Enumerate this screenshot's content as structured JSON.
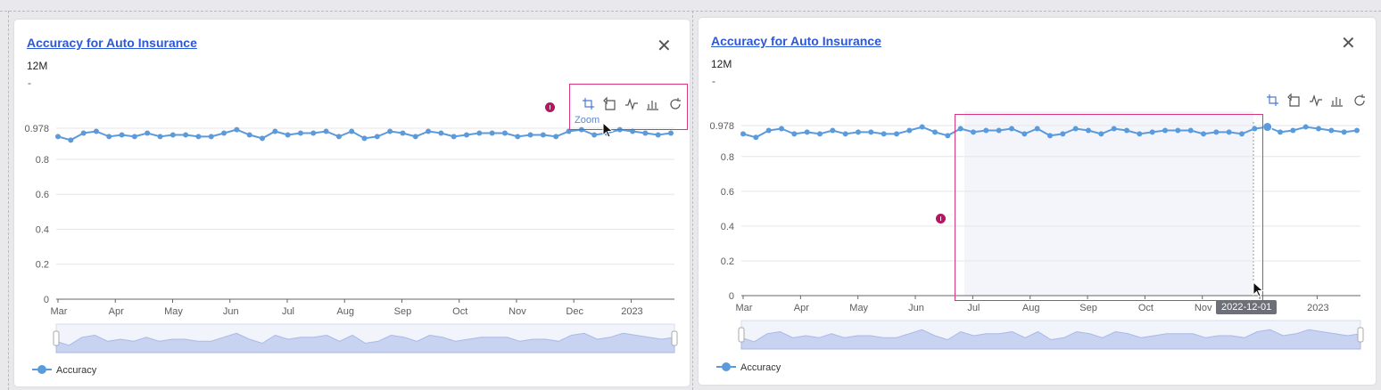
{
  "colors": {
    "accent": "#2b58d8",
    "series": "#5b9bdc",
    "highlight": "#d6377f",
    "info": "#b4175f"
  },
  "cards": [
    {
      "title": "Accuracy for Auto Insurance",
      "subtitle": "12M",
      "dash": "-",
      "close_icon": "close-icon",
      "toolbox": {
        "icons": [
          "zoom-icon",
          "zoom-reset-icon",
          "line-chart-icon",
          "bar-chart-icon",
          "restore-icon"
        ],
        "tooltip": "Zoom"
      },
      "legend": "Accuracy"
    },
    {
      "title": "Accuracy for Auto Insurance",
      "subtitle": "12M",
      "dash": "-",
      "close_icon": "close-icon",
      "toolbox": {
        "icons": [
          "zoom-icon",
          "zoom-reset-icon",
          "line-chart-icon",
          "bar-chart-icon",
          "restore-icon"
        ]
      },
      "legend": "Accuracy",
      "axis_tooltip": "2022-12-01"
    }
  ],
  "chart_data": [
    {
      "type": "line",
      "series": [
        {
          "name": "Accuracy",
          "values": [
            0.93,
            0.91,
            0.95,
            0.96,
            0.93,
            0.94,
            0.93,
            0.95,
            0.93,
            0.94,
            0.94,
            0.93,
            0.93,
            0.95,
            0.97,
            0.94,
            0.92,
            0.96,
            0.94,
            0.95,
            0.95,
            0.96,
            0.93,
            0.96,
            0.92,
            0.93,
            0.96,
            0.95,
            0.93,
            0.96,
            0.95,
            0.93,
            0.94,
            0.95,
            0.95,
            0.95,
            0.93,
            0.94,
            0.94,
            0.93,
            0.96,
            0.97,
            0.94,
            0.95,
            0.97,
            0.96,
            0.95,
            0.94,
            0.95
          ]
        }
      ],
      "x_ticks": [
        "Mar",
        "Apr",
        "May",
        "Jun",
        "Jul",
        "Aug",
        "Sep",
        "Oct",
        "Nov",
        "Dec",
        "2023"
      ],
      "y_ticks": [
        "0",
        "0.2",
        "0.4",
        "0.6",
        "0.8",
        "0.978"
      ],
      "ylim": [
        0,
        0.978
      ],
      "grid": true,
      "legend": "bottom-left"
    },
    {
      "type": "line",
      "series": [
        {
          "name": "Accuracy",
          "values": [
            0.93,
            0.91,
            0.95,
            0.96,
            0.93,
            0.94,
            0.93,
            0.95,
            0.93,
            0.94,
            0.94,
            0.93,
            0.93,
            0.95,
            0.97,
            0.94,
            0.92,
            0.96,
            0.94,
            0.95,
            0.95,
            0.96,
            0.93,
            0.96,
            0.92,
            0.93,
            0.96,
            0.95,
            0.93,
            0.96,
            0.95,
            0.93,
            0.94,
            0.95,
            0.95,
            0.95,
            0.93,
            0.94,
            0.94,
            0.93,
            0.96,
            0.97,
            0.94,
            0.95,
            0.97,
            0.96,
            0.95,
            0.94,
            0.95
          ]
        }
      ],
      "x_ticks": [
        "Mar",
        "Apr",
        "May",
        "Jun",
        "Jul",
        "Aug",
        "Sep",
        "Oct",
        "Nov",
        "Dec",
        "2023"
      ],
      "y_ticks": [
        "0",
        "0.2",
        "0.4",
        "0.6",
        "0.8",
        "0.978"
      ],
      "ylim": [
        0,
        0.978
      ],
      "grid": true,
      "legend": "bottom-left"
    }
  ]
}
